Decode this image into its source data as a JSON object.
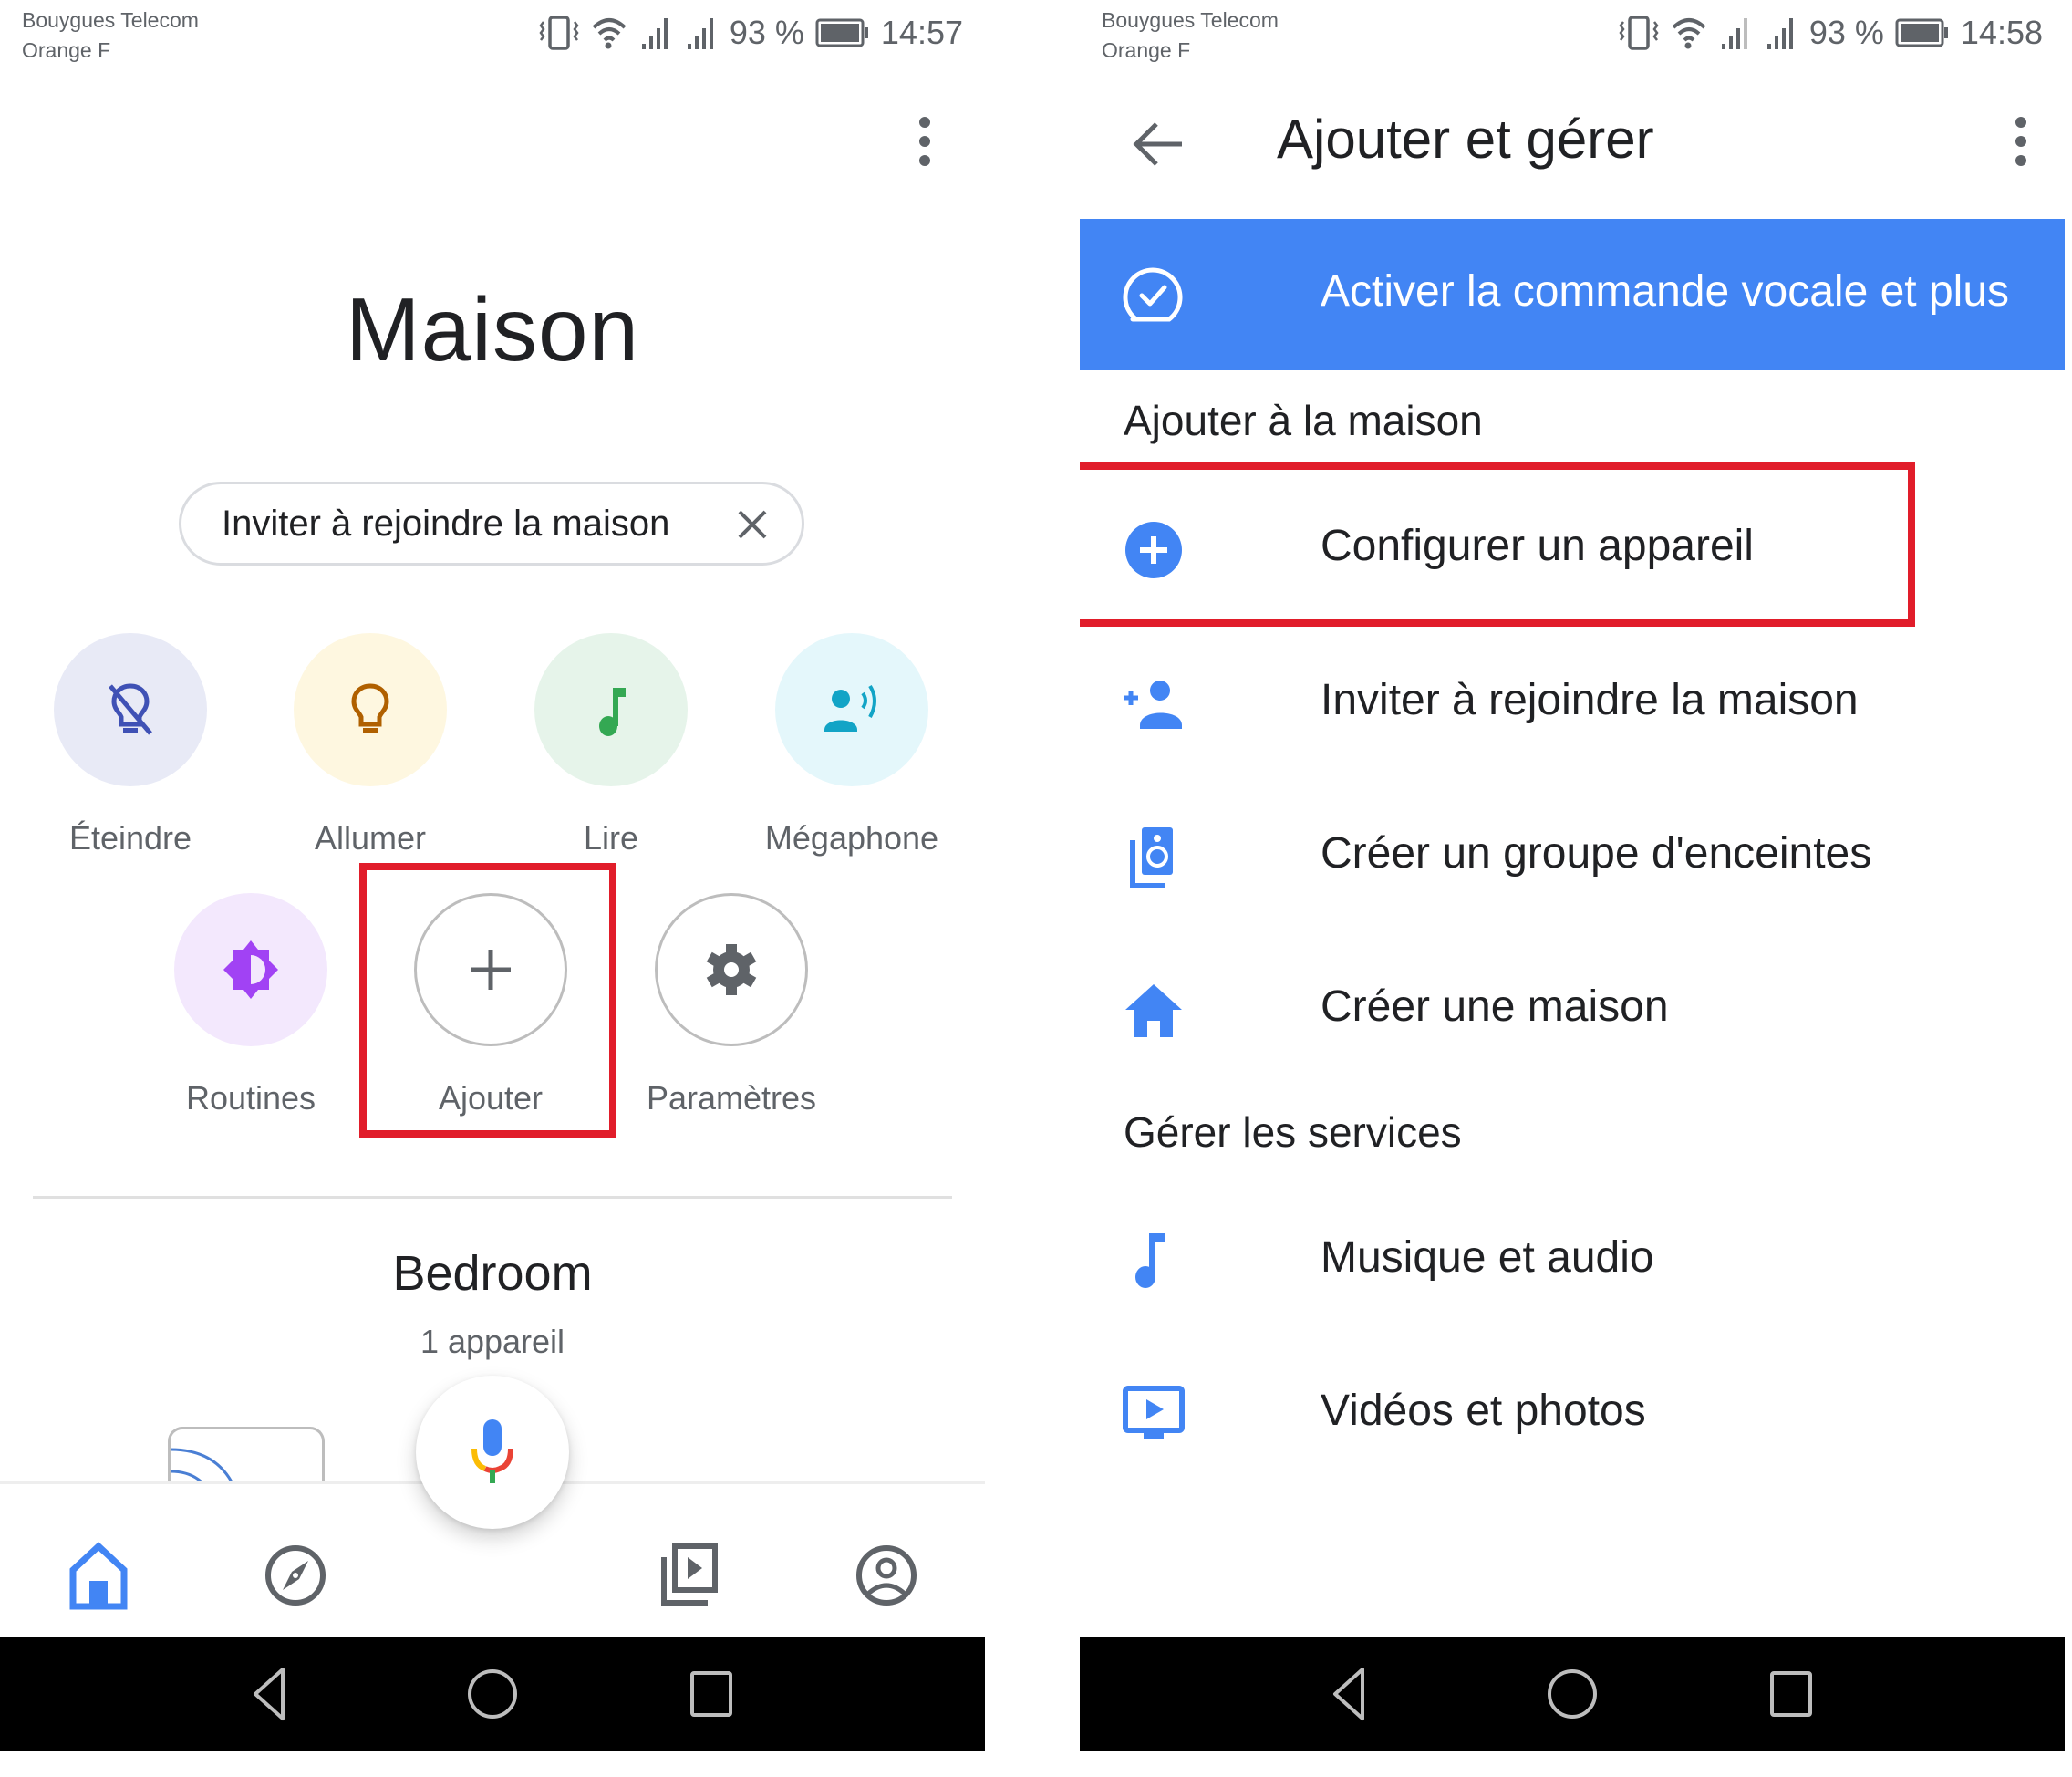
{
  "left_screen": {
    "status_bar": {
      "carrier_1": "Bouygues Telecom",
      "carrier_2": "Orange F",
      "battery_percent": "93 %",
      "time": "14:57",
      "icons": [
        "vibrate-icon",
        "wifi-icon",
        "signal-icon",
        "signal-icon",
        "battery-icon"
      ]
    },
    "title": "Maison",
    "invite_chip": {
      "label": "Inviter à rejoindre la maison",
      "close_icon": "close-icon"
    },
    "actions": [
      {
        "label": "Éteindre",
        "icon": "lightbulb-off-icon",
        "bg": "#e8eaf6",
        "fg": "#3f51b5"
      },
      {
        "label": "Allumer",
        "icon": "lightbulb-icon",
        "bg": "#fef7e0",
        "fg": "#b06000"
      },
      {
        "label": "Lire",
        "icon": "music-note-icon",
        "bg": "#e6f4ea",
        "fg": "#34a853"
      },
      {
        "label": "Mégaphone",
        "icon": "broadcast-icon",
        "bg": "#e4f7fb",
        "fg": "#12a4c6"
      },
      {
        "label": "Routines",
        "icon": "routine-icon",
        "bg": "#f3e8fd",
        "fg": "#a142f4"
      },
      {
        "label": "Ajouter",
        "icon": "plus-icon",
        "bg": "#ffffff",
        "fg": "#5f6368",
        "highlighted": true
      },
      {
        "label": "Paramètres",
        "icon": "gear-icon",
        "bg": "#ffffff",
        "fg": "#5f6368"
      }
    ],
    "room": {
      "name": "Bedroom",
      "device_count": "1 appareil"
    },
    "bottom_nav": [
      {
        "name": "home",
        "icon": "home-icon",
        "active": true
      },
      {
        "name": "discover",
        "icon": "compass-icon",
        "active": false
      },
      {
        "name": "media",
        "icon": "media-library-icon",
        "active": false
      },
      {
        "name": "account",
        "icon": "account-icon",
        "active": false
      }
    ],
    "mic_button": {
      "icon": "google-mic-icon"
    }
  },
  "right_screen": {
    "status_bar": {
      "carrier_1": "Bouygues Telecom",
      "carrier_2": "Orange F",
      "battery_percent": "93 %",
      "time": "14:58"
    },
    "title": "Ajouter et gérer",
    "banner": {
      "label": "Activer la commande vocale et plus",
      "icon": "voice-check-icon"
    },
    "sections": [
      {
        "heading": "Ajouter à la maison",
        "items": [
          {
            "label": "Configurer un appareil",
            "icon": "add-circle-icon",
            "highlighted": true
          },
          {
            "label": "Inviter à rejoindre la maison",
            "icon": "person-add-icon"
          },
          {
            "label": "Créer un groupe d'enceintes",
            "icon": "speaker-group-icon"
          },
          {
            "label": "Créer une maison",
            "icon": "home-icon"
          }
        ]
      },
      {
        "heading": "Gérer les services",
        "items": [
          {
            "label": "Musique et audio",
            "icon": "music-note-icon"
          },
          {
            "label": "Vidéos et photos",
            "icon": "video-icon"
          }
        ]
      }
    ]
  },
  "colors": {
    "accent_blue": "#4285f4",
    "highlight_red": "#e11d2a",
    "text_primary": "#202124",
    "text_secondary": "#5f6368"
  }
}
